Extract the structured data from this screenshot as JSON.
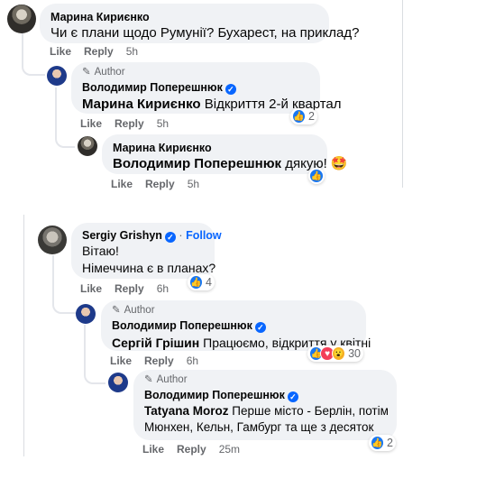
{
  "thread1": {
    "top": {
      "name": "Марина Кириєнко",
      "text": "Чи є плани щодо Румунії? Бухарест, на приклад?",
      "like": "Like",
      "reply": "Reply",
      "time": "5h"
    },
    "reply1": {
      "author_badge": "Author",
      "name": "Володимир Поперешнюк",
      "mention": "Марина Кириєнко",
      "text": " Відкриття 2-й квартал",
      "like": "Like",
      "reply": "Reply",
      "time": "5h",
      "reactions": "2"
    },
    "reply2": {
      "name": "Марина Кириєнко",
      "mention": "Володимир Поперешнюк",
      "text": " дякую! 🤩",
      "like": "Like",
      "reply": "Reply",
      "time": "5h"
    }
  },
  "thread2": {
    "top": {
      "name": "Sergiy Grishyn",
      "follow": "Follow",
      "separator": "·",
      "line1": "Вітаю!",
      "line2": "Німеччина є в планах?",
      "like": "Like",
      "reply": "Reply",
      "time": "6h",
      "reactions": "4"
    },
    "reply1": {
      "author_badge": "Author",
      "name": "Володимир Поперешнюк",
      "mention": "Сергій Грішин",
      "text": " Працюємо, відкриття у квітні",
      "like": "Like",
      "reply": "Reply",
      "time": "6h",
      "reactions": "30"
    },
    "reply2": {
      "author_badge": "Author",
      "name": "Володимир Поперешнюк",
      "mention": "Tatyana Moroz",
      "line1": " Перше місто - Берлін, потім",
      "line2": "Мюнхен, Кельн, Гамбург та ще з десяток",
      "like": "Like",
      "reply": "Reply",
      "time": "25m",
      "reactions": "2"
    }
  },
  "colors": {
    "accent": "#0866ff",
    "bubble": "#f0f2f5",
    "muted": "#65676b",
    "line": "#e4e6eb"
  },
  "icons": [
    "pencil-icon",
    "verified-badge-icon",
    "like-reaction-icon",
    "love-reaction-icon",
    "wow-reaction-icon"
  ]
}
